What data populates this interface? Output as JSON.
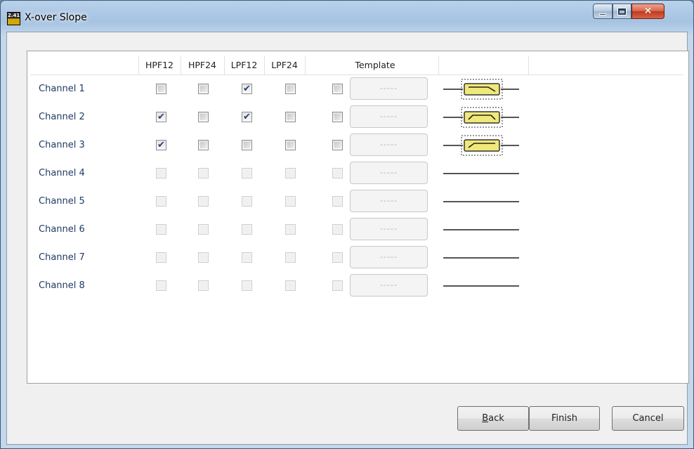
{
  "window": {
    "title": "X-over Slope",
    "app_icon_text": "2.41"
  },
  "table": {
    "columns": [
      "HPF12",
      "HPF24",
      "LPF12",
      "LPF24",
      "Template"
    ],
    "rows": [
      {
        "label": "Channel 1",
        "hpf12": false,
        "hpf24": false,
        "lpf12": true,
        "lpf24": false,
        "enabled": true,
        "template": "-----",
        "curve": "lpf"
      },
      {
        "label": "Channel 2",
        "hpf12": true,
        "hpf24": false,
        "lpf12": true,
        "lpf24": false,
        "enabled": true,
        "template": "-----",
        "curve": "bandpass"
      },
      {
        "label": "Channel 3",
        "hpf12": true,
        "hpf24": false,
        "lpf12": false,
        "lpf24": false,
        "enabled": true,
        "template": "-----",
        "curve": "hpf"
      },
      {
        "label": "Channel 4",
        "hpf12": false,
        "hpf24": false,
        "lpf12": false,
        "lpf24": false,
        "enabled": false,
        "template": "-----",
        "curve": "flat"
      },
      {
        "label": "Channel 5",
        "hpf12": false,
        "hpf24": false,
        "lpf12": false,
        "lpf24": false,
        "enabled": false,
        "template": "-----",
        "curve": "flat"
      },
      {
        "label": "Channel 6",
        "hpf12": false,
        "hpf24": false,
        "lpf12": false,
        "lpf24": false,
        "enabled": false,
        "template": "-----",
        "curve": "flat"
      },
      {
        "label": "Channel 7",
        "hpf12": false,
        "hpf24": false,
        "lpf12": false,
        "lpf24": false,
        "enabled": false,
        "template": "-----",
        "curve": "flat"
      },
      {
        "label": "Channel 8",
        "hpf12": false,
        "hpf24": false,
        "lpf12": false,
        "lpf24": false,
        "enabled": false,
        "template": "-----",
        "curve": "flat"
      }
    ]
  },
  "buttons": {
    "back_mnemonic": "B",
    "back_rest": "ack",
    "finish": "Finish",
    "cancel": "Cancel"
  },
  "colors": {
    "channel_label": "#1f3b63",
    "filter_fill": "#f0e878",
    "tick": "#2a3f7a"
  },
  "icons": {
    "close": "close-icon",
    "minimize": "minimize-icon",
    "maximize": "maximize-icon",
    "check": "checkmark-icon"
  }
}
